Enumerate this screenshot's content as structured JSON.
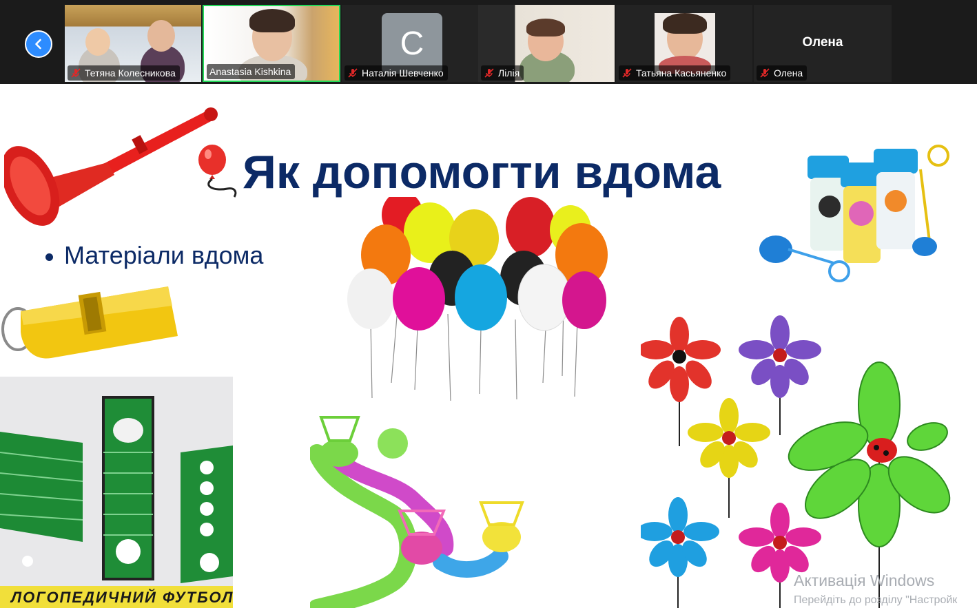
{
  "meeting": {
    "nav_icon": "chevron-left-icon",
    "participants": [
      {
        "name": "Тетяна Колесникова",
        "muted": true,
        "video": true,
        "active": false
      },
      {
        "name": "Anastasia Kishkina",
        "muted": false,
        "video": true,
        "active": true
      },
      {
        "name": "Наталія Шевченко",
        "muted": true,
        "video": false,
        "initial": "C",
        "active": false
      },
      {
        "name": "Лілія",
        "muted": true,
        "video": true,
        "active": false
      },
      {
        "name": "Татьяна Касьяненко",
        "muted": true,
        "video": true,
        "active": false
      },
      {
        "name": "Олена",
        "muted": true,
        "video": false,
        "display_name": "Олена",
        "active": false
      }
    ]
  },
  "slide": {
    "title": "Як допомогти вдома",
    "bullet": "Матеріали вдома",
    "football_caption": "ЛОГОПЕДИЧНИЙ ФУТБОЛ",
    "colors": {
      "title": "#0c2a66",
      "active_border": "#23d959",
      "nav": "#2d8cff"
    }
  },
  "watermark": {
    "line1": "Активація Windows",
    "line2": "Перейдіть до розділу \"Настройк"
  }
}
